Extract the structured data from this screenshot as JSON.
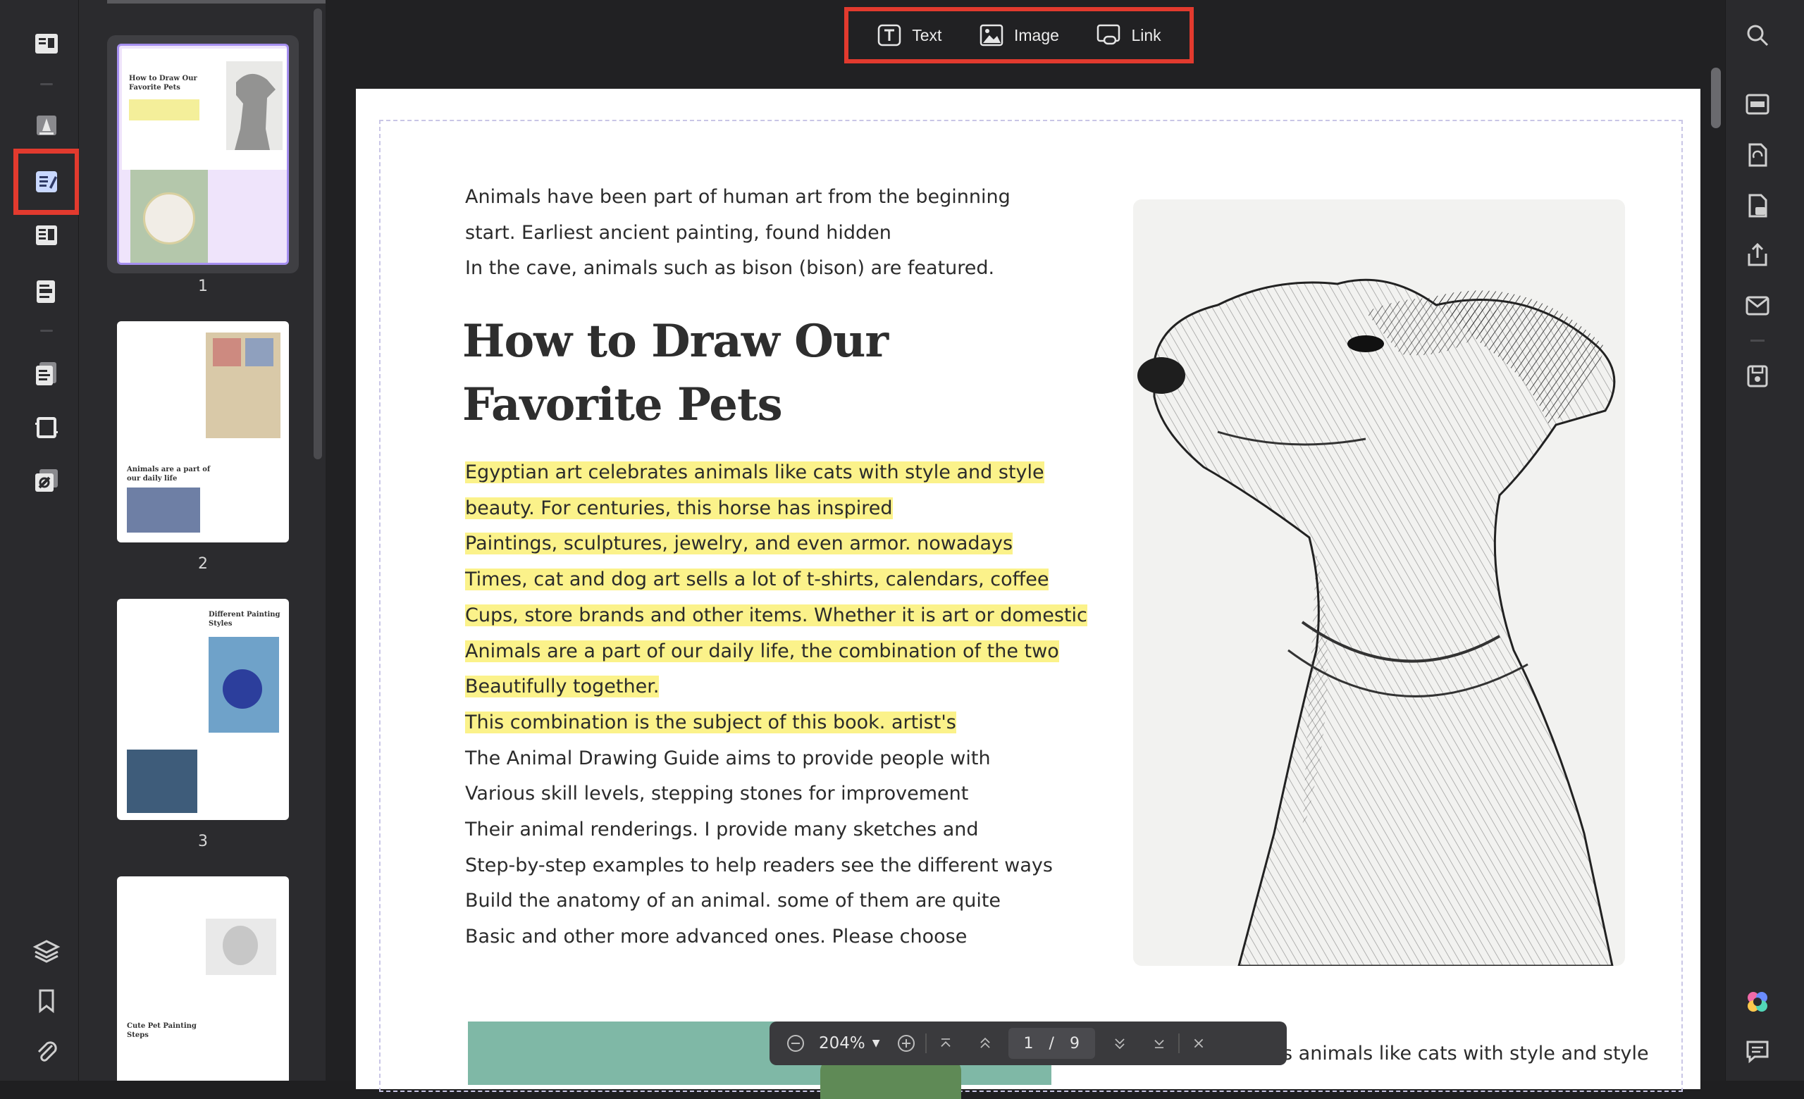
{
  "top_toolbar": {
    "text_label": "Text",
    "image_label": "Image",
    "link_label": "Link"
  },
  "left_toolbar": {
    "items": [
      "reader-icon",
      "highlighter-icon",
      "edit-pdf-icon",
      "page-organize-icon",
      "form-icon",
      "convert-icon",
      "crop-icon",
      "batch-icon",
      "layers-icon",
      "bookmark-icon",
      "attachment-icon"
    ]
  },
  "right_toolbar": {
    "items": [
      "search-icon",
      "ocr-icon",
      "convert-file-icon",
      "protect-icon",
      "share-icon",
      "mail-icon",
      "save-icon",
      "ai-icon",
      "comment-icon"
    ]
  },
  "thumbnails": [
    {
      "page": "1",
      "title_line1": "How to Draw Our",
      "title_line2": "Favorite Pets"
    },
    {
      "page": "2",
      "caption_line1": "Animals are a part of",
      "caption_line2": "our daily life"
    },
    {
      "page": "3",
      "title_line1": "Different Painting",
      "title_line2": "Styles"
    },
    {
      "page": "",
      "title_line1": "Cute Pet Painting",
      "title_line2": "Steps"
    }
  ],
  "document": {
    "intro": [
      "Animals have been part of human art from the beginning",
      "start. Earliest ancient painting, found hidden",
      "In the cave, animals such as bison (bison) are featured."
    ],
    "title_line1": "How to Draw Our",
    "title_line2": "Favorite Pets",
    "highlighted": [
      "Egyptian art celebrates animals like cats with style and style",
      "beauty. For centuries, this horse has inspired",
      "Paintings, sculptures, jewelry, and even armor. nowadays",
      "Times, cat and dog art sells a lot of t-shirts, calendars, coffee",
      "Cups, store brands and other items. Whether it is art or domestic",
      "Animals are a part of our daily life, the combination of the two",
      "Beautifully together.",
      "This combination is the subject of this book. artist's"
    ],
    "plain": [
      "The Animal Drawing Guide aims to provide people with",
      "Various skill levels, stepping stones for improvement",
      "Their animal renderings. I provide many sketches and",
      "Step-by-step examples to help readers see the different ways",
      "Build the anatomy of an animal. some of them are quite",
      "Basic and other more advanced ones. Please choose"
    ],
    "bottom_text": "s animals like cats with style and style"
  },
  "pager": {
    "zoom": "204%",
    "current_page": "1",
    "separator": "/",
    "total_pages": "9"
  },
  "colors": {
    "highlight": "#fbf28a",
    "annotation_box": "#e23a2e",
    "accent": "#6a8cff"
  }
}
